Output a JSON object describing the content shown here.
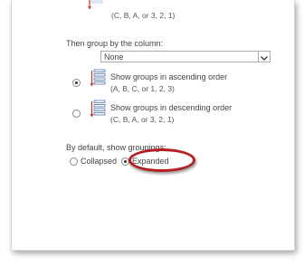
{
  "top_option": {
    "description": "(C, B, A, or 3, 2, 1)"
  },
  "group_by": {
    "label": "Then group by the column:",
    "selected": "None",
    "ascending": {
      "title": "Show groups in ascending order",
      "description": "(A, B, C, or 1, 2, 3)",
      "checked": true
    },
    "descending": {
      "title": "Show groups in descending order",
      "description": "(C, B, A, or 3, 2, 1)",
      "checked": false
    }
  },
  "default_show": {
    "label": "By default, show groupings:",
    "collapsed": {
      "label": "Collapsed",
      "checked": false
    },
    "expanded": {
      "label": "Expanded",
      "checked": true
    }
  },
  "colors": {
    "highlight": "#b41e23",
    "icon_blue": "#2f5ea8",
    "icon_red": "#c0392b"
  }
}
